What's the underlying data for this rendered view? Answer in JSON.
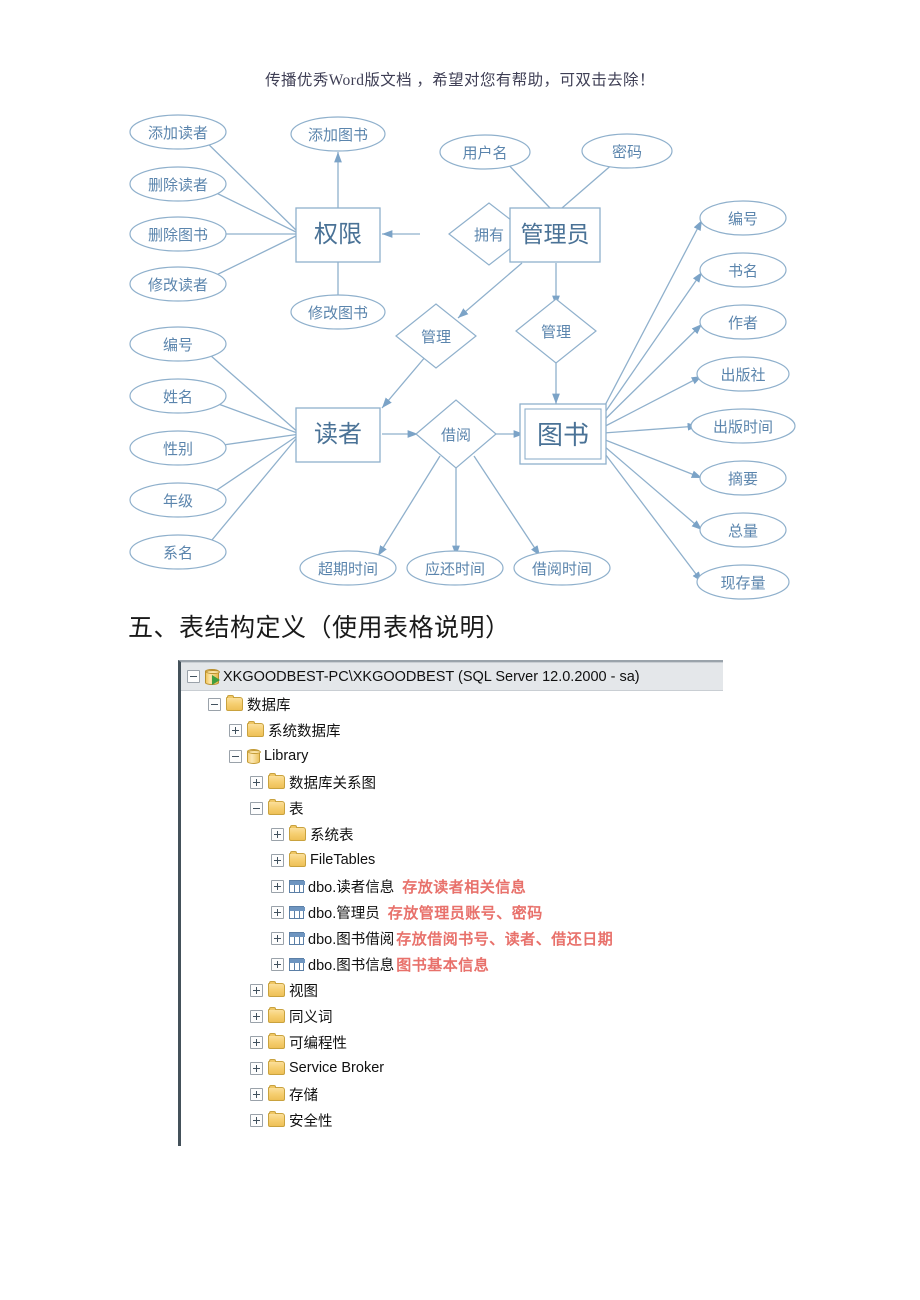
{
  "watermark": "传播优秀Word版文档 ，希望对您有帮助，可双击去除！",
  "section": {
    "heading": "五、表结构定义（使用表格说明）"
  },
  "er_diagram": {
    "entities": [
      {
        "id": "quanxian",
        "label": "权限"
      },
      {
        "id": "guanliyuan",
        "label": "管理员"
      },
      {
        "id": "duzhe",
        "label": "读者"
      },
      {
        "id": "tushu",
        "label": "图书"
      }
    ],
    "relationships": [
      {
        "id": "yongyou",
        "label": "拥有"
      },
      {
        "id": "guanli1",
        "label": "管理"
      },
      {
        "id": "guanli2",
        "label": "管理"
      },
      {
        "id": "jieyue",
        "label": "借阅"
      }
    ],
    "attributes": {
      "quanxian": [
        "添加读者",
        "删除读者",
        "删除图书",
        "修改读者",
        "添加图书",
        "修改图书"
      ],
      "guanliyuan": [
        "用户名",
        "密码"
      ],
      "duzhe": [
        "编号",
        "姓名",
        "性别",
        "年级",
        "系名"
      ],
      "jieyue": [
        "超期时间",
        "应还时间",
        "借阅时间"
      ],
      "tushu": [
        "编号",
        "书名",
        "作者",
        "出版社",
        "出版时间",
        "摘要",
        "总量",
        "现存量"
      ]
    },
    "colors": {
      "stroke": "#8fb0cc",
      "text": "#5b85ad",
      "entity_text": "#4a7296"
    }
  },
  "ssms_tree": {
    "nodes": [
      {
        "id": "server",
        "label": "XKGOODBEST-PC\\XKGOODBEST (SQL Server 12.0.2000 - sa)",
        "icon": "server-icon",
        "expander": "minus",
        "indent": 0,
        "selected": true,
        "annotation": ""
      },
      {
        "id": "databases",
        "label": "数据库",
        "icon": "folder-icon",
        "expander": "minus",
        "indent": 1,
        "selected": false,
        "annotation": ""
      },
      {
        "id": "system-databases",
        "label": "系统数据库",
        "icon": "folder-icon",
        "expander": "plus",
        "indent": 2,
        "selected": false,
        "annotation": ""
      },
      {
        "id": "library",
        "label": "Library",
        "icon": "database-icon",
        "expander": "minus",
        "indent": 2,
        "selected": false,
        "annotation": ""
      },
      {
        "id": "db-diagrams",
        "label": "数据库关系图",
        "icon": "folder-icon",
        "expander": "plus",
        "indent": 3,
        "selected": false,
        "annotation": ""
      },
      {
        "id": "tables",
        "label": "表",
        "icon": "folder-icon",
        "expander": "minus",
        "indent": 3,
        "selected": false,
        "annotation": ""
      },
      {
        "id": "system-tables",
        "label": "系统表",
        "icon": "folder-icon",
        "expander": "plus",
        "indent": 4,
        "selected": false,
        "annotation": ""
      },
      {
        "id": "filetables",
        "label": "FileTables",
        "icon": "folder-icon",
        "expander": "plus",
        "indent": 4,
        "selected": false,
        "annotation": ""
      },
      {
        "id": "tbl-reader",
        "label": "dbo.读者信息",
        "icon": "table-icon",
        "expander": "plus",
        "indent": 4,
        "selected": false,
        "annotation": "存放读者相关信息"
      },
      {
        "id": "tbl-admin",
        "label": "dbo.管理员",
        "icon": "table-icon",
        "expander": "plus",
        "indent": 4,
        "selected": false,
        "annotation": "存放管理员账号、密码"
      },
      {
        "id": "tbl-borrow",
        "label": "dbo.图书借阅",
        "icon": "table-icon",
        "expander": "plus",
        "indent": 4,
        "selected": false,
        "annotation": "存放借阅书号、读者、借还日期"
      },
      {
        "id": "tbl-book",
        "label": "dbo.图书信息",
        "icon": "table-icon",
        "expander": "plus",
        "indent": 4,
        "selected": false,
        "annotation": "图书基本信息"
      },
      {
        "id": "views",
        "label": "视图",
        "icon": "folder-icon",
        "expander": "plus",
        "indent": 3,
        "selected": false,
        "annotation": ""
      },
      {
        "id": "synonyms",
        "label": "同义词",
        "icon": "folder-icon",
        "expander": "plus",
        "indent": 3,
        "selected": false,
        "annotation": ""
      },
      {
        "id": "programmability",
        "label": "可编程性",
        "icon": "folder-icon",
        "expander": "plus",
        "indent": 3,
        "selected": false,
        "annotation": ""
      },
      {
        "id": "service-broker",
        "label": "Service Broker",
        "icon": "folder-icon",
        "expander": "plus",
        "indent": 3,
        "selected": false,
        "annotation": ""
      },
      {
        "id": "storage",
        "label": "存储",
        "icon": "folder-icon",
        "expander": "plus",
        "indent": 3,
        "selected": false,
        "annotation": ""
      },
      {
        "id": "security",
        "label": "安全性",
        "icon": "folder-icon",
        "expander": "plus",
        "indent": 3,
        "selected": false,
        "annotation": ""
      }
    ],
    "annotation_color": "#e8716b"
  }
}
